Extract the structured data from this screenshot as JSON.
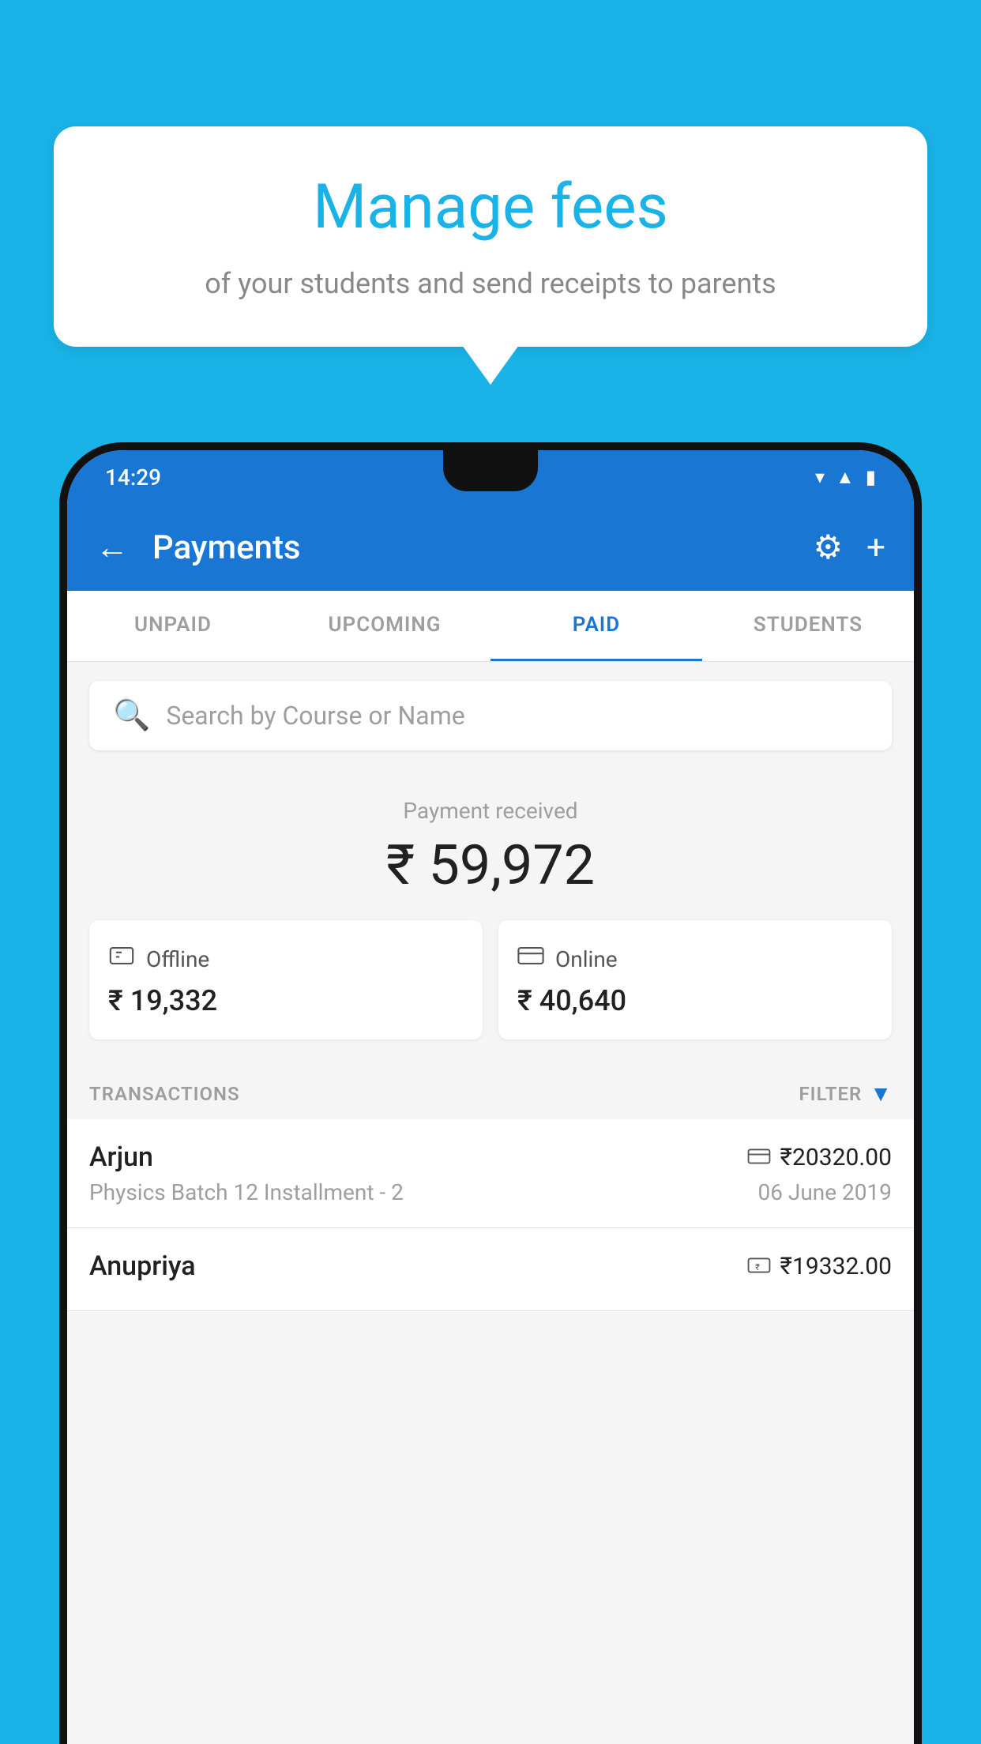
{
  "page": {
    "background_color": "#1ab3e8"
  },
  "speech_bubble": {
    "title": "Manage fees",
    "subtitle": "of your students and send receipts to parents"
  },
  "status_bar": {
    "time": "14:29"
  },
  "app_bar": {
    "title": "Payments",
    "back_label": "←",
    "settings_label": "⚙",
    "add_label": "+"
  },
  "tabs": [
    {
      "label": "UNPAID",
      "active": false
    },
    {
      "label": "UPCOMING",
      "active": false
    },
    {
      "label": "PAID",
      "active": true
    },
    {
      "label": "STUDENTS",
      "active": false
    }
  ],
  "search": {
    "placeholder": "Search by Course or Name"
  },
  "payment_summary": {
    "label": "Payment received",
    "amount": "₹ 59,972",
    "offline": {
      "type": "Offline",
      "amount": "₹ 19,332"
    },
    "online": {
      "type": "Online",
      "amount": "₹ 40,640"
    }
  },
  "transactions": {
    "header_label": "TRANSACTIONS",
    "filter_label": "FILTER",
    "items": [
      {
        "name": "Arjun",
        "course": "Physics Batch 12 Installment - 2",
        "amount": "₹20320.00",
        "date": "06 June 2019",
        "payment_type": "online"
      },
      {
        "name": "Anupriya",
        "course": "",
        "amount": "₹19332.00",
        "date": "",
        "payment_type": "offline"
      }
    ]
  }
}
